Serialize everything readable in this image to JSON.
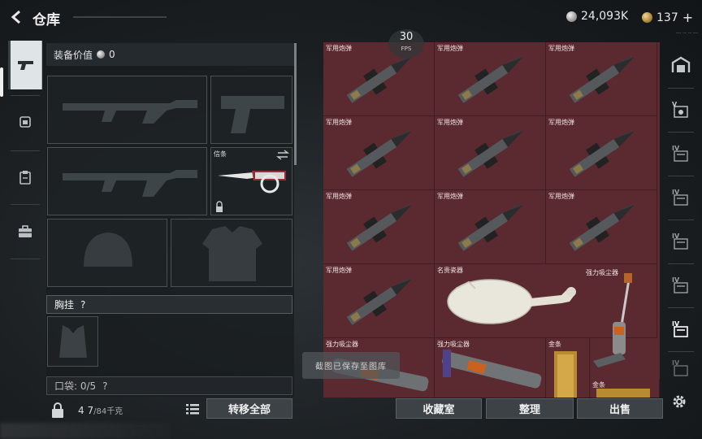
{
  "header": {
    "title": "仓库",
    "silver_amount": "24,093K",
    "gold_amount": "137",
    "gold_plus": "+",
    "sub_text": "--- -- -- ---"
  },
  "left_nav": {
    "items": [
      {
        "name": "pistol-icon",
        "active": true
      },
      {
        "name": "helmet-badge-icon",
        "active": false
      },
      {
        "name": "clipboard-icon",
        "active": false
      },
      {
        "name": "briefcase-icon",
        "active": false
      }
    ]
  },
  "equipment": {
    "value_label": "装备价值",
    "value_amount": "0",
    "melee_label": "信条",
    "chest_rig_label": "胸挂",
    "chest_rig_help": "?",
    "pocket_label": "口袋: 0/5",
    "pocket_help": "?"
  },
  "fps": {
    "value": "30",
    "label": "FPS"
  },
  "grid": {
    "items": [
      {
        "label": "军用炮弹"
      },
      {
        "label": "军用炮弹"
      },
      {
        "label": "军用炮弹"
      },
      {
        "label": "军用炮弹"
      },
      {
        "label": "军用炮弹"
      },
      {
        "label": "军用炮弹"
      },
      {
        "label": "军用炮弹"
      },
      {
        "label": "军用炮弹"
      },
      {
        "label": "军用炮弹"
      },
      {
        "label": "军用炮弹"
      }
    ],
    "vase_label": "名贵瓷器",
    "vacuum_labels": [
      "强力吸尘器",
      "强力吸尘器",
      "强力吸尘器"
    ],
    "gold_bar_labels": [
      "金条",
      "金条"
    ]
  },
  "right_nav": {
    "items": [
      {
        "name": "gate-icon",
        "tier": ""
      },
      {
        "name": "case-v-icon",
        "tier": "V"
      },
      {
        "name": "case-iv-icon",
        "tier": "IV"
      },
      {
        "name": "case-iv-icon",
        "tier": "IV"
      },
      {
        "name": "case-iv-icon",
        "tier": "IV"
      },
      {
        "name": "case-iv-icon",
        "tier": "IV"
      },
      {
        "name": "case-iv-selected-icon",
        "tier": "IV"
      },
      {
        "name": "case-iv-icon",
        "tier": "IV"
      }
    ]
  },
  "toast": {
    "text": "截图已保存至图库"
  },
  "bottom": {
    "capacity_value": "4 7",
    "capacity_unit": "/84千克",
    "transfer_all": "转移全部",
    "collection_room": "收藏室",
    "organize": "整理",
    "sell": "出售"
  },
  "colors": {
    "grid_background": "#5b2a30",
    "active_tab": "#dfe4e6",
    "button_fill": "#3c4246"
  }
}
